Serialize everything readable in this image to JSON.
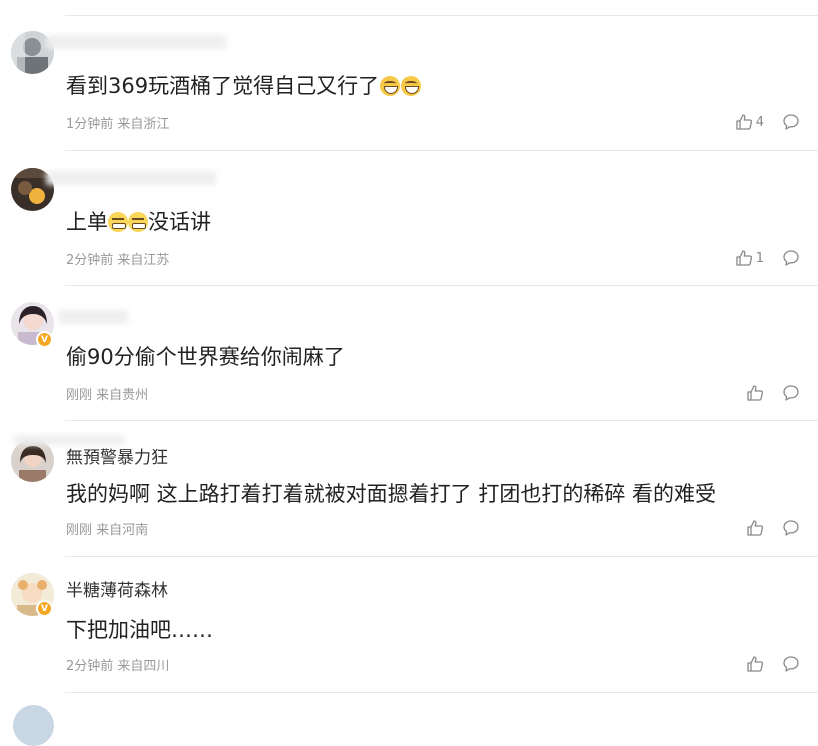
{
  "comments": [
    {
      "username": "",
      "content": "看到369玩酒桶了觉得自己又行了",
      "time": "1分钟前",
      "location": "来自浙江",
      "likes": "4",
      "emoji": "laugh",
      "emoji_count": 2,
      "verified": false
    },
    {
      "username": "",
      "content_pre": "上单",
      "content_post": "没话讲",
      "time": "2分钟前",
      "location": "来自江苏",
      "likes": "1",
      "emoji": "grin",
      "emoji_count": 2,
      "verified": false
    },
    {
      "username": "",
      "content": "偷90分偷个世界赛给你闹麻了",
      "time": "刚刚",
      "location": "来自贵州",
      "likes": "",
      "verified": true
    },
    {
      "username": "無預警暴力狂",
      "content": "我的妈啊 这上路打着打着就被对面摁着打了 打团也打的稀碎 看的难受",
      "time": "刚刚",
      "location": "来自河南",
      "likes": "",
      "verified": false
    },
    {
      "username": "半糖薄荷森林",
      "content": "下把加油吧……",
      "time": "2分钟前",
      "location": "来自四川",
      "likes": "",
      "verified": true
    }
  ],
  "icons": {
    "like": "thumbs-up-icon",
    "reply": "comment-bubble-icon",
    "verified": "verified-badge-icon"
  },
  "colors": {
    "text": "#333333",
    "meta": "#999999",
    "divider": "#e8e8e8",
    "badge": "#f5a623"
  }
}
